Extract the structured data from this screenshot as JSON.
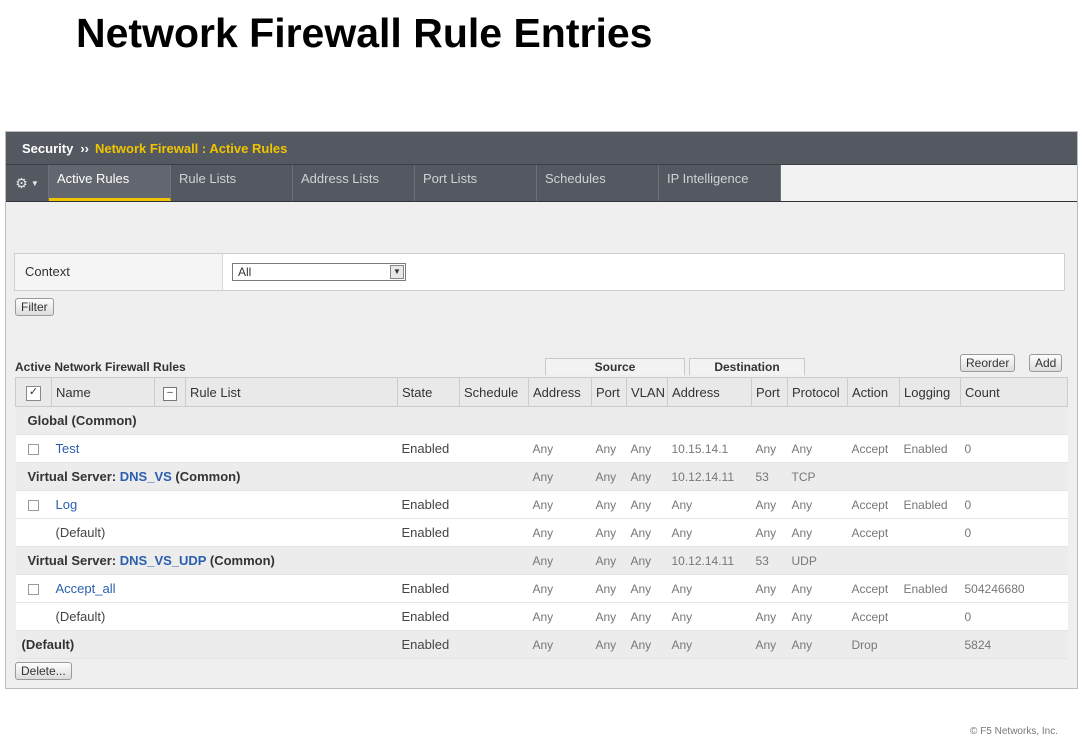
{
  "slide": {
    "title": "Network Firewall Rule Entries",
    "copyright": "© F5 Networks, Inc."
  },
  "breadcrumb": {
    "root": "Security",
    "separator": "››",
    "path": "Network Firewall : Active Rules"
  },
  "tabs": [
    {
      "label": "Active Rules",
      "active": true
    },
    {
      "label": "Rule Lists",
      "active": false
    },
    {
      "label": "Address Lists",
      "active": false
    },
    {
      "label": "Port Lists",
      "active": false
    },
    {
      "label": "Schedules",
      "active": false
    },
    {
      "label": "IP Intelligence",
      "active": false
    }
  ],
  "gear_icon": "gear-icon",
  "context": {
    "label": "Context",
    "selected": "All"
  },
  "buttons": {
    "filter": "Filter",
    "reorder": "Reorder",
    "add": "Add",
    "delete": "Delete..."
  },
  "table": {
    "heading": "Active Network Firewall Rules",
    "group_source": "Source",
    "group_destination": "Destination",
    "columns": [
      "Name",
      "Rule List",
      "State",
      "Schedule",
      "Address",
      "Port",
      "VLAN",
      "Address",
      "Port",
      "Protocol",
      "Action",
      "Logging",
      "Count"
    ],
    "groups": {
      "global": "Global (Common)",
      "vs1_prefix": "Virtual Server:",
      "vs1_name": "DNS_VS",
      "vs1_suffix": "(Common)",
      "vs2_prefix": "Virtual Server:",
      "vs2_name": "DNS_VS_UDP",
      "vs2_suffix": "(Common)",
      "default": "(Default)"
    },
    "rows": {
      "test": {
        "name": "Test",
        "state": "Enabled",
        "src_addr": "Any",
        "src_port": "Any",
        "vlan": "Any",
        "dst_addr": "10.15.14.1",
        "dst_port": "Any",
        "protocol": "Any",
        "action": "Accept",
        "logging": "Enabled",
        "count": "0"
      },
      "vs1": {
        "src_addr": "Any",
        "src_port": "Any",
        "vlan": "Any",
        "dst_addr": "10.12.14.11",
        "dst_port": "53",
        "protocol": "TCP"
      },
      "log": {
        "name": "Log",
        "state": "Enabled",
        "src_addr": "Any",
        "src_port": "Any",
        "vlan": "Any",
        "dst_addr": "Any",
        "dst_port": "Any",
        "protocol": "Any",
        "action": "Accept",
        "logging": "Enabled",
        "count": "0"
      },
      "vs1_default": {
        "name": "(Default)",
        "state": "Enabled",
        "src_addr": "Any",
        "src_port": "Any",
        "vlan": "Any",
        "dst_addr": "Any",
        "dst_port": "Any",
        "protocol": "Any",
        "action": "Accept",
        "count": "0"
      },
      "vs2": {
        "src_addr": "Any",
        "src_port": "Any",
        "vlan": "Any",
        "dst_addr": "10.12.14.11",
        "dst_port": "53",
        "protocol": "UDP"
      },
      "accept_all": {
        "name": "Accept_all",
        "state": "Enabled",
        "src_addr": "Any",
        "src_port": "Any",
        "vlan": "Any",
        "dst_addr": "Any",
        "dst_port": "Any",
        "protocol": "Any",
        "action": "Accept",
        "logging": "Enabled",
        "count": "504246680"
      },
      "vs2_default": {
        "name": "(Default)",
        "state": "Enabled",
        "src_addr": "Any",
        "src_port": "Any",
        "vlan": "Any",
        "dst_addr": "Any",
        "dst_port": "Any",
        "protocol": "Any",
        "action": "Accept",
        "count": "0"
      },
      "global_default": {
        "state": "Enabled",
        "src_addr": "Any",
        "src_port": "Any",
        "vlan": "Any",
        "dst_addr": "Any",
        "dst_port": "Any",
        "protocol": "Any",
        "action": "Drop",
        "count": "5824"
      }
    }
  },
  "colors": {
    "tabbar": "#545961",
    "accent": "#f0c400",
    "link": "#2a5fb0"
  }
}
